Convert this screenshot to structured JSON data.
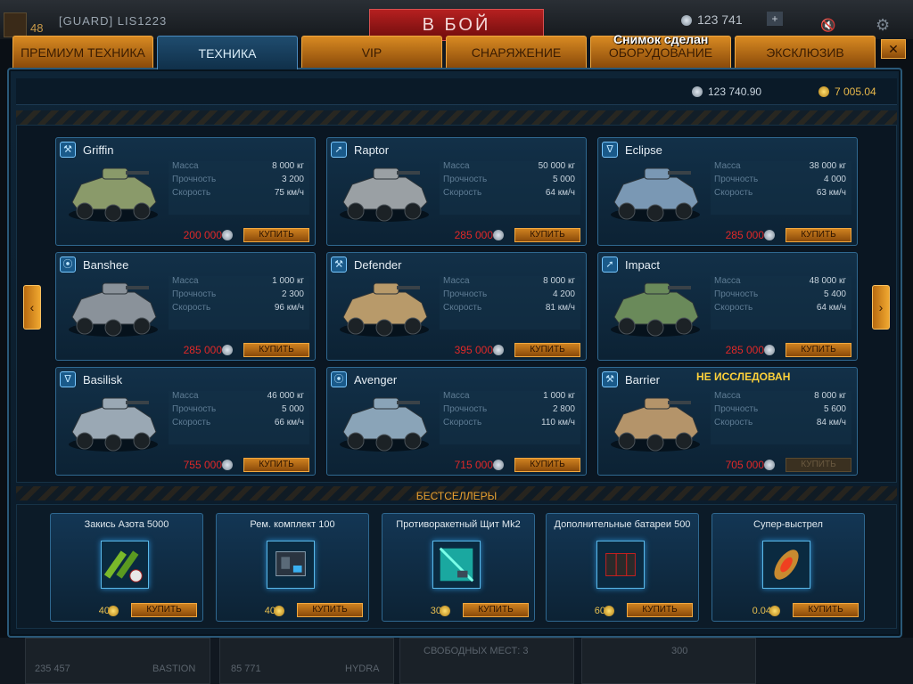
{
  "hud": {
    "level": "48",
    "player_name": "[GUARD] LIS1223",
    "fight_label": "В БОЙ",
    "silver": "123 741",
    "plus": "+"
  },
  "overlay": {
    "screenshot_notice": "Снимок сделан"
  },
  "tabs": [
    {
      "label": "ПРЕМИУМ ТЕХНИКА",
      "active": false
    },
    {
      "label": "ТЕХНИКА",
      "active": true
    },
    {
      "label": "VIP",
      "active": false
    },
    {
      "label": "СНАРЯЖЕНИЕ",
      "active": false
    },
    {
      "label": "ОБОРУДОВАНИЕ",
      "active": false
    },
    {
      "label": "ЭКСКЛЮЗИВ",
      "active": false
    }
  ],
  "close_label": "✕",
  "balance": {
    "silver": "123 740.90",
    "gold": "7 005.04"
  },
  "stat_labels": {
    "mass": "Масса",
    "durability": "Прочность",
    "speed": "Скорость"
  },
  "buy_label": "КУПИТЬ",
  "vehicles": [
    {
      "name": "Griffin",
      "mass": "8 000 кг",
      "durability": "3 200",
      "speed": "75 км/ч",
      "price": "200 000",
      "color": "#8a9a6a"
    },
    {
      "name": "Raptor",
      "mass": "50 000 кг",
      "durability": "5 000",
      "speed": "64 км/ч",
      "price": "285 000",
      "color": "#9aa0a4"
    },
    {
      "name": "Eclipse",
      "mass": "38 000 кг",
      "durability": "4 000",
      "speed": "63 км/ч",
      "price": "285 000",
      "color": "#7a98b4"
    },
    {
      "name": "Banshee",
      "mass": "1 000 кг",
      "durability": "2 300",
      "speed": "96 км/ч",
      "price": "285 000",
      "color": "#8a929a"
    },
    {
      "name": "Defender",
      "mass": "8 000 кг",
      "durability": "4 200",
      "speed": "81 км/ч",
      "price": "395 000",
      "color": "#b89a6a"
    },
    {
      "name": "Impact",
      "mass": "48 000 кг",
      "durability": "5 400",
      "speed": "64 км/ч",
      "price": "285 000",
      "color": "#6a8a5a"
    },
    {
      "name": "Basilisk",
      "mass": "46 000 кг",
      "durability": "5 000",
      "speed": "66 км/ч",
      "price": "755 000",
      "color": "#9aa8b4"
    },
    {
      "name": "Avenger",
      "mass": "1 000 кг",
      "durability": "2 800",
      "speed": "110 км/ч",
      "price": "715 000",
      "color": "#8aa4b8"
    },
    {
      "name": "Barrier",
      "mass": "8 000 кг",
      "durability": "5 600",
      "speed": "84 км/ч",
      "price": "705 000",
      "color": "#b4946a",
      "disabled": true
    }
  ],
  "not_researched": "НЕ ИССЛЕДОВАН",
  "bestsellers_title": "БЕСТСЕЛЛЕРЫ",
  "bestsellers": [
    {
      "name": "Закись Азота 5000",
      "price": "40"
    },
    {
      "name": "Рем. комплект 100",
      "price": "40"
    },
    {
      "name": "Противоракетный Щит Mk2",
      "price": "30"
    },
    {
      "name": "Дополнительные батареи 500",
      "price": "60"
    },
    {
      "name": "Супер-выстрел",
      "price": "0.04"
    }
  ],
  "bottom_bar": {
    "slot1_value": "235 457",
    "slot1_name": "BASTION",
    "slot2_value": "85 771",
    "slot2_name": "HYDRA",
    "free_slots": "СВОБОДНЫХ МЕСТ: 3",
    "slot4_value": "300"
  }
}
